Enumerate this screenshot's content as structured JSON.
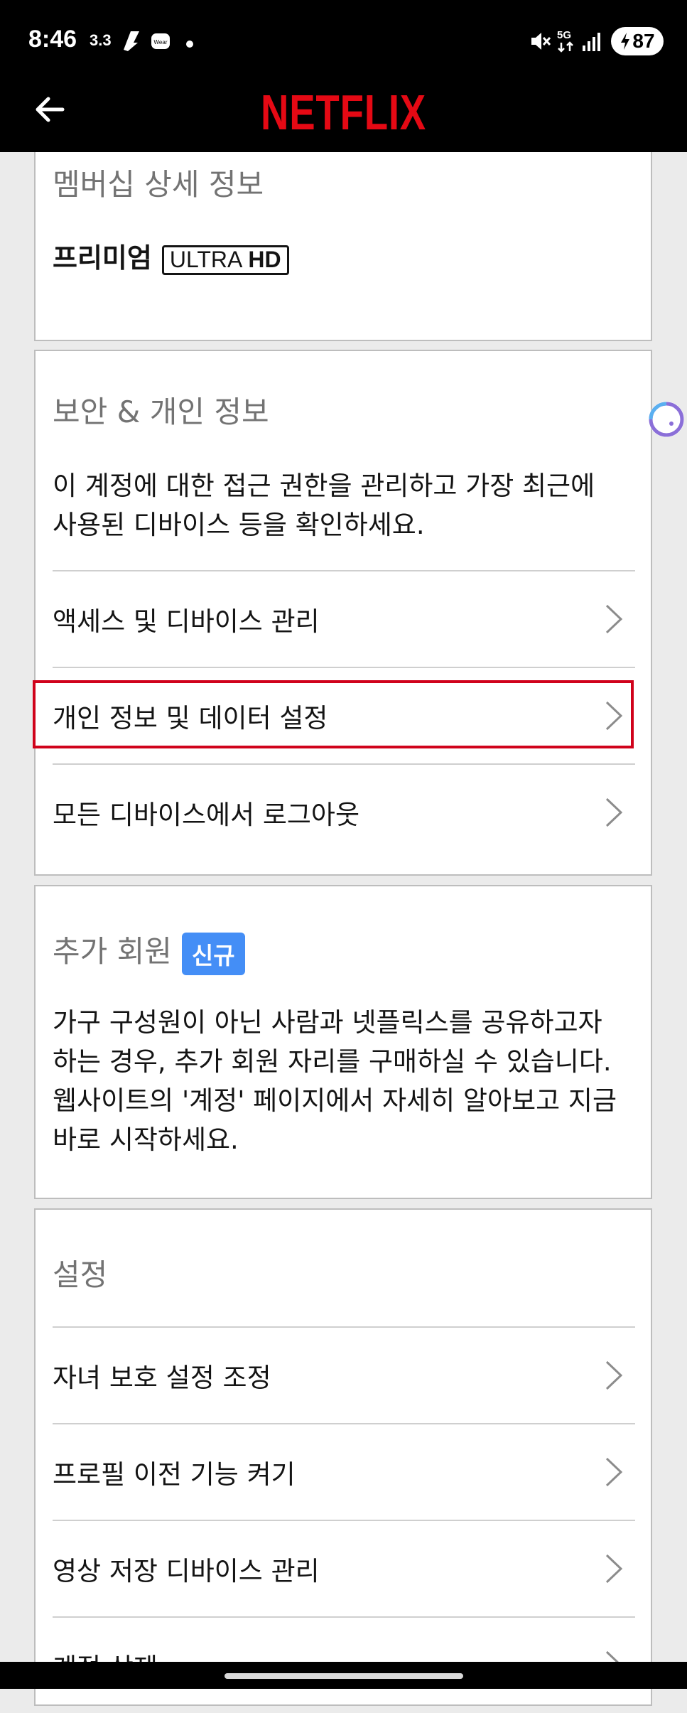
{
  "status_bar": {
    "time": "8:46",
    "speed": "3.3",
    "battery": "87"
  },
  "header": {
    "logo": "NETFLIX",
    "brand_color": "#e50914"
  },
  "membership": {
    "title": "멤버십 상세 정보",
    "plan": "프리미엄",
    "plan_badge_a": "ULTRA",
    "plan_badge_b": "HD"
  },
  "security": {
    "title": "보안 & 개인 정보",
    "description_line1": "이 계정에 대한 접근 권한을 관리하고 가장 최근에",
    "description_line2": "사용된 디바이스 등을 확인하세요.",
    "items": [
      {
        "label": "액세스 및 디바이스 관리"
      },
      {
        "label": "개인 정보 및 데이터 설정"
      },
      {
        "label": "모든 디바이스에서 로그아웃"
      }
    ]
  },
  "extra_member": {
    "title": "추가 회원",
    "badge": "신규",
    "badge_color": "#448ef6",
    "description_line1": "가구 구성원이 아닌 사람과 넷플릭스를 공유하고자",
    "description_line2": "하는 경우, 추가 회원 자리를 구매하실 수 있습니다.",
    "description_line3": "웹사이트의 '계정' 페이지에서 자세히 알아보고 지금",
    "description_line4": "바로 시작하세요."
  },
  "settings": {
    "title": "설정",
    "items": [
      {
        "label": "자녀 보호 설정 조정"
      },
      {
        "label": "프로필 이전 기능 켜기"
      },
      {
        "label": "영상 저장 디바이스 관리"
      },
      {
        "label": "계정 삭제"
      }
    ]
  },
  "highlight_color": "#d0021b"
}
